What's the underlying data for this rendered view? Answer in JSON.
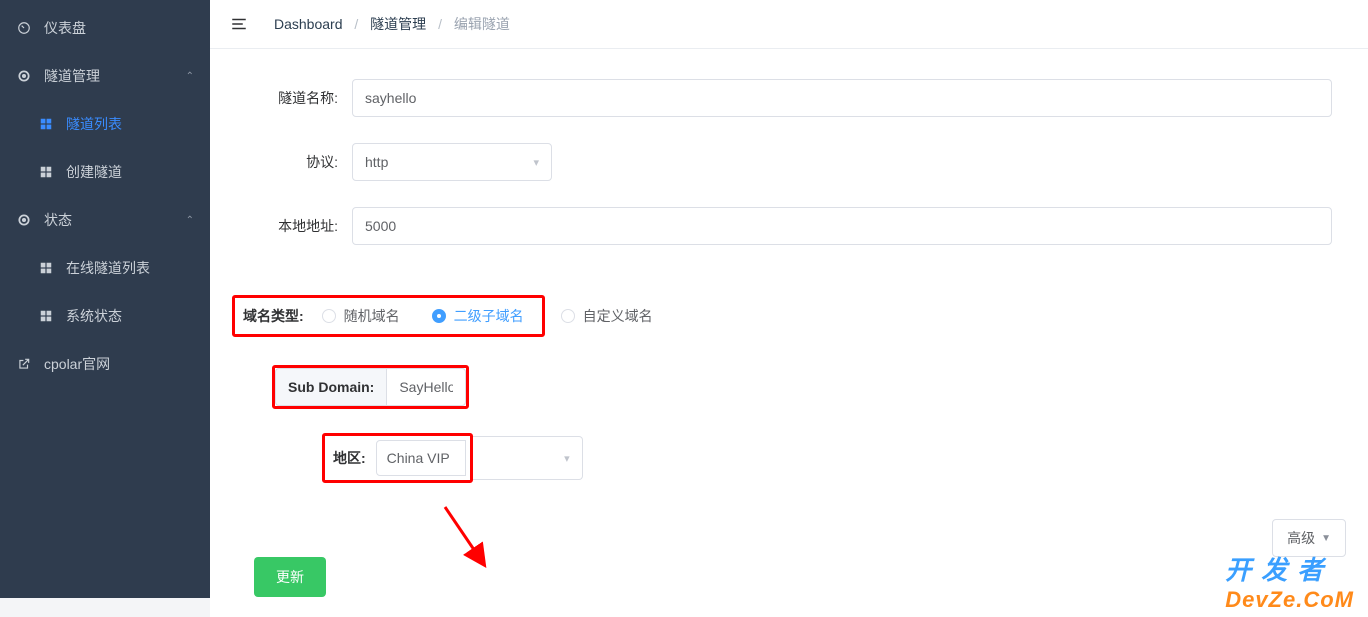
{
  "sidebar": {
    "items": [
      {
        "label": "仪表盘"
      },
      {
        "label": "隧道管理"
      },
      {
        "label": "隧道列表"
      },
      {
        "label": "创建隧道"
      },
      {
        "label": "状态"
      },
      {
        "label": "在线隧道列表"
      },
      {
        "label": "系统状态"
      },
      {
        "label": "cpolar官网"
      }
    ]
  },
  "breadcrumb": {
    "a": "Dashboard",
    "b": "隧道管理",
    "c": "编辑隧道"
  },
  "form": {
    "name_label": "隧道名称:",
    "name_value": "sayhello",
    "proto_label": "协议:",
    "proto_value": "http",
    "local_label": "本地地址:",
    "local_value": "5000",
    "domain_type_label": "域名类型:",
    "radio_random": "随机域名",
    "radio_sub": "二级子域名",
    "radio_custom": "自定义域名",
    "subdomain_label": "Sub Domain:",
    "subdomain_value": "SayHello",
    "region_label": "地区:",
    "region_value": "China VIP",
    "advanced": "高级",
    "update": "更新"
  },
  "watermark": {
    "top": "开发者",
    "bot": "DevZe.CoM"
  }
}
